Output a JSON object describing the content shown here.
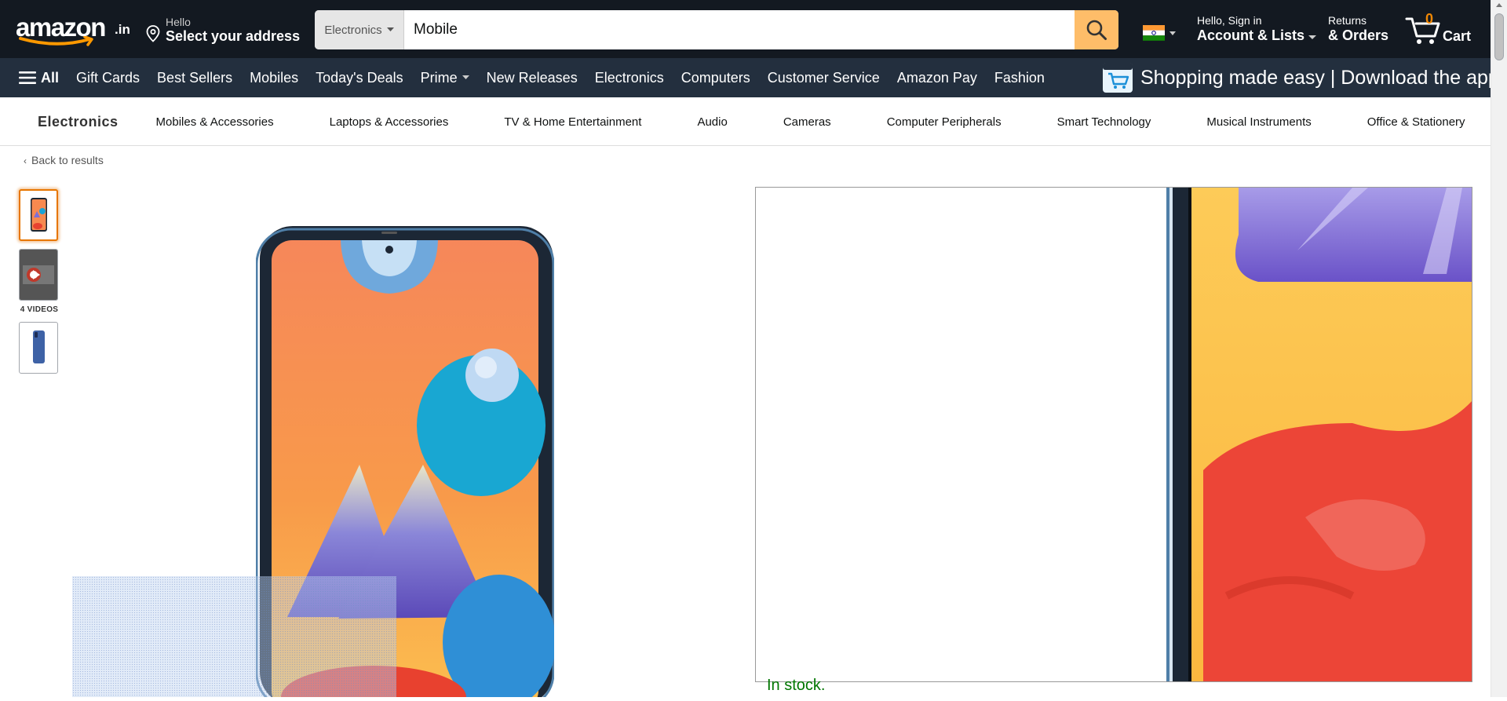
{
  "header": {
    "logo_text": "amazon",
    "logo_tld": ".in",
    "address_line1": "Hello",
    "address_line2": "Select your address",
    "search_category": "Electronics",
    "search_value": "Mobile",
    "account_line1": "Hello, Sign in",
    "account_line2": "Account & Lists",
    "returns_line1": "Returns",
    "returns_line2": "& Orders",
    "cart_count": "0",
    "cart_label": "Cart"
  },
  "main_nav": {
    "all_label": "All",
    "items": [
      "Gift Cards",
      "Best Sellers",
      "Mobiles",
      "Today's Deals",
      "Prime",
      "New Releases",
      "Electronics",
      "Computers",
      "Customer Service",
      "Amazon Pay",
      "Fashion"
    ],
    "promo_text": "Shopping made easy | Download the app"
  },
  "sub_nav": {
    "title": "Electronics",
    "items": [
      "Mobiles & Accessories",
      "Laptops & Accessories",
      "TV & Home Entertainment",
      "Audio",
      "Cameras",
      "Computer Peripherals",
      "Smart Technology",
      "Musical Instruments",
      "Office & Stationery"
    ]
  },
  "back_link": "Back to results",
  "gallery": {
    "videos_label": "4 VIDEOS"
  },
  "availability": "In stock.",
  "colors": {
    "nav_dark": "#131921",
    "nav_secondary": "#232f3e",
    "search_button": "#febd69",
    "cart_count": "#f08804",
    "in_stock": "#007600",
    "thumb_selected": "#e77600"
  }
}
